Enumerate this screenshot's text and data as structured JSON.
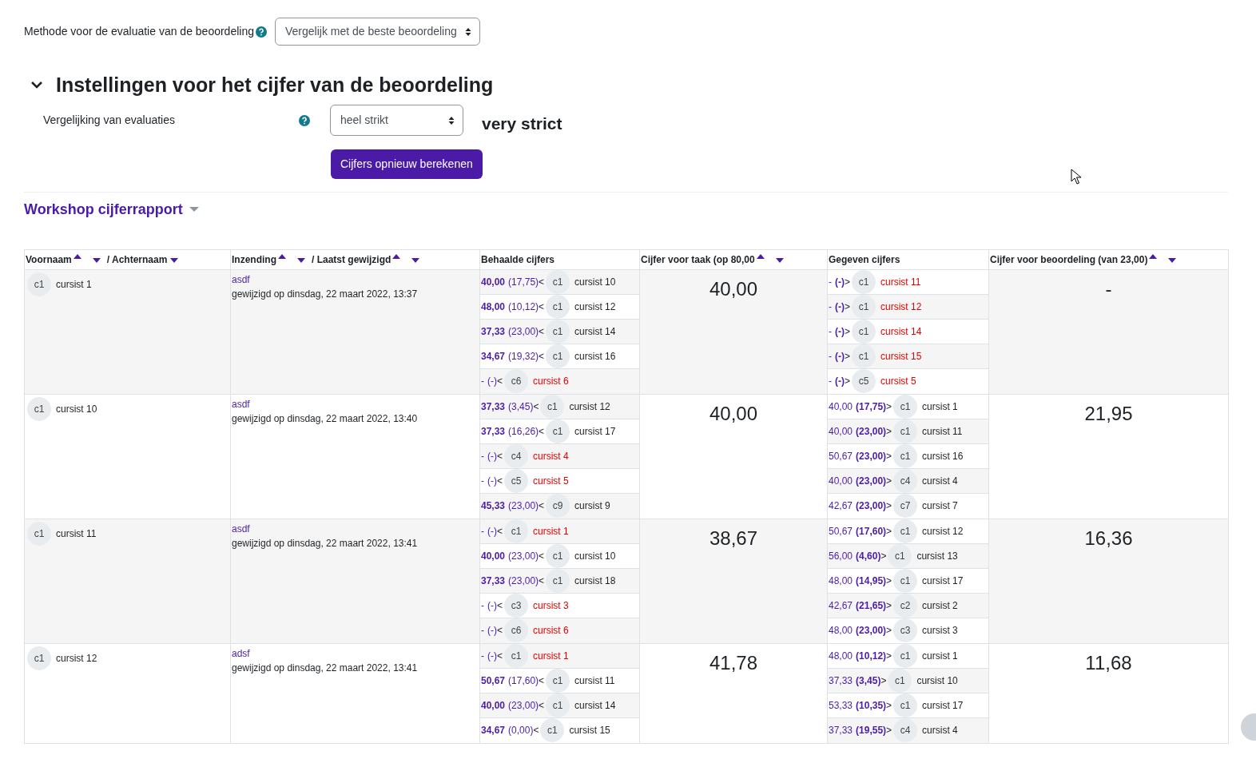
{
  "method": {
    "label": "Methode voor de evaluatie van de beoordeling",
    "value": "Vergelijk met de beste beoordeling"
  },
  "section": {
    "title": "Instellingen voor het cijfer van de beoordeling",
    "expanded": true,
    "field_label": "Vergelijking van evaluaties",
    "field_value": "heel strikt",
    "note": "very strict",
    "button": "Cijfers opnieuw berekenen"
  },
  "report": {
    "title": "Workshop cijferrapport"
  },
  "table": {
    "columns": [
      {
        "parts": [
          {
            "label": "Voornaam",
            "sort_up": true,
            "sort_down": true
          },
          {
            "label": "/ Achternaam",
            "sort_up": false,
            "sort_down": true
          }
        ]
      },
      {
        "parts": [
          {
            "label": "Inzending",
            "sort_up": true,
            "sort_down": true
          },
          {
            "label": "/ Laatst gewijzigd",
            "sort_up": true,
            "sort_down": true
          }
        ]
      },
      {
        "parts": [
          {
            "label": "Behaalde cijfers",
            "sort_up": false,
            "sort_down": false
          }
        ]
      },
      {
        "parts": [
          {
            "label": "Cijfer voor taak (op 80,00",
            "sort_up": true,
            "sort_down": true
          }
        ]
      },
      {
        "parts": [
          {
            "label": "Gegeven cijfers",
            "sort_up": false,
            "sort_down": false
          }
        ]
      },
      {
        "parts": [
          {
            "label": "Cijfer voor beoordeling (van 23,00)",
            "sort_up": true,
            "sort_down": true
          }
        ]
      }
    ],
    "rows": [
      {
        "avatar": "c1",
        "name": "cursist 1",
        "submission": "asdf",
        "modified": "gewijzigd op dinsdag, 22 maart 2022, 13:37",
        "task_grade": "40,00",
        "assessment_grade": "-",
        "received": [
          {
            "grade": "40,00",
            "weight": "(17,75)",
            "arrow": "<",
            "avatar": "c1",
            "name": "cursist 10",
            "done": true
          },
          {
            "grade": "48,00",
            "weight": "(10,12)",
            "arrow": "<",
            "avatar": "c1",
            "name": "cursist 12",
            "done": true
          },
          {
            "grade": "37,33",
            "weight": "(23,00)",
            "arrow": "<",
            "avatar": "c1",
            "name": "cursist 14",
            "done": true
          },
          {
            "grade": "34,67",
            "weight": "(19,32)",
            "arrow": "<",
            "avatar": "c1",
            "name": "cursist 16",
            "done": true
          },
          {
            "grade": "-",
            "weight": "(-)",
            "arrow": "<",
            "avatar": "c6",
            "name": "cursist 6",
            "done": false
          }
        ],
        "given": [
          {
            "grade": "-",
            "weight": "(-)",
            "arrow": ">",
            "avatar": "c1",
            "name": "cursist 11",
            "done": false
          },
          {
            "grade": "-",
            "weight": "(-)",
            "arrow": ">",
            "avatar": "c1",
            "name": "cursist 12",
            "done": false
          },
          {
            "grade": "-",
            "weight": "(-)",
            "arrow": ">",
            "avatar": "c1",
            "name": "cursist 14",
            "done": false
          },
          {
            "grade": "-",
            "weight": "(-)",
            "arrow": ">",
            "avatar": "c1",
            "name": "cursist 15",
            "done": false
          },
          {
            "grade": "-",
            "weight": "(-)",
            "arrow": ">",
            "avatar": "c5",
            "name": "cursist 5",
            "done": false
          }
        ]
      },
      {
        "avatar": "c1",
        "name": "cursist 10",
        "submission": "asdf",
        "modified": "gewijzigd op dinsdag, 22 maart 2022, 13:40",
        "task_grade": "40,00",
        "assessment_grade": "21,95",
        "received": [
          {
            "grade": "37,33",
            "weight": "(3,45)",
            "arrow": "<",
            "avatar": "c1",
            "name": "cursist 12",
            "done": true
          },
          {
            "grade": "37,33",
            "weight": "(16,26)",
            "arrow": "<",
            "avatar": "c1",
            "name": "cursist 17",
            "done": true
          },
          {
            "grade": "-",
            "weight": "(-)",
            "arrow": "<",
            "avatar": "c4",
            "name": "cursist 4",
            "done": false
          },
          {
            "grade": "-",
            "weight": "(-)",
            "arrow": "<",
            "avatar": "c5",
            "name": "cursist 5",
            "done": false
          },
          {
            "grade": "45,33",
            "weight": "(23,00)",
            "arrow": "<",
            "avatar": "c9",
            "name": "cursist 9",
            "done": true
          }
        ],
        "given": [
          {
            "grade": "40,00",
            "weight": "(17,75)",
            "arrow": ">",
            "avatar": "c1",
            "name": "cursist 1",
            "done": true
          },
          {
            "grade": "40,00",
            "weight": "(23,00)",
            "arrow": ">",
            "avatar": "c1",
            "name": "cursist 11",
            "done": true
          },
          {
            "grade": "50,67",
            "weight": "(23,00)",
            "arrow": ">",
            "avatar": "c1",
            "name": "cursist 16",
            "done": true
          },
          {
            "grade": "40,00",
            "weight": "(23,00)",
            "arrow": ">",
            "avatar": "c4",
            "name": "cursist 4",
            "done": true
          },
          {
            "grade": "42,67",
            "weight": "(23,00)",
            "arrow": ">",
            "avatar": "c7",
            "name": "cursist 7",
            "done": true
          }
        ]
      },
      {
        "avatar": "c1",
        "name": "cursist 11",
        "submission": "asdf",
        "modified": "gewijzigd op dinsdag, 22 maart 2022, 13:41",
        "task_grade": "38,67",
        "assessment_grade": "16,36",
        "received": [
          {
            "grade": "-",
            "weight": "(-)",
            "arrow": "<",
            "avatar": "c1",
            "name": "cursist 1",
            "done": false
          },
          {
            "grade": "40,00",
            "weight": "(23,00)",
            "arrow": "<",
            "avatar": "c1",
            "name": "cursist 10",
            "done": true
          },
          {
            "grade": "37,33",
            "weight": "(23,00)",
            "arrow": "<",
            "avatar": "c1",
            "name": "cursist 18",
            "done": true
          },
          {
            "grade": "-",
            "weight": "(-)",
            "arrow": "<",
            "avatar": "c3",
            "name": "cursist 3",
            "done": false
          },
          {
            "grade": "-",
            "weight": "(-)",
            "arrow": "<",
            "avatar": "c6",
            "name": "cursist 6",
            "done": false
          }
        ],
        "given": [
          {
            "grade": "50,67",
            "weight": "(17,60)",
            "arrow": ">",
            "avatar": "c1",
            "name": "cursist 12",
            "done": true
          },
          {
            "grade": "56,00",
            "weight": "(4,60)",
            "arrow": ">",
            "avatar": "c1",
            "name": "cursist 13",
            "done": true
          },
          {
            "grade": "48,00",
            "weight": "(14,95)",
            "arrow": ">",
            "avatar": "c1",
            "name": "cursist 17",
            "done": true
          },
          {
            "grade": "42,67",
            "weight": "(21,65)",
            "arrow": ">",
            "avatar": "c2",
            "name": "cursist 2",
            "done": true
          },
          {
            "grade": "48,00",
            "weight": "(23,00)",
            "arrow": ">",
            "avatar": "c3",
            "name": "cursist 3",
            "done": true
          }
        ]
      },
      {
        "avatar": "c1",
        "name": "cursist 12",
        "submission": "adsf",
        "modified": "gewijzigd op dinsdag, 22 maart 2022, 13:41",
        "task_grade": "41,78",
        "assessment_grade": "11,68",
        "received": [
          {
            "grade": "-",
            "weight": "(-)",
            "arrow": "<",
            "avatar": "c1",
            "name": "cursist 1",
            "done": false
          },
          {
            "grade": "50,67",
            "weight": "(17,60)",
            "arrow": "<",
            "avatar": "c1",
            "name": "cursist 11",
            "done": true
          },
          {
            "grade": "40,00",
            "weight": "(23,00)",
            "arrow": "<",
            "avatar": "c1",
            "name": "cursist 14",
            "done": true
          },
          {
            "grade": "34,67",
            "weight": "(0,00)",
            "arrow": "<",
            "avatar": "c1",
            "name": "cursist 15",
            "done": true
          }
        ],
        "given": [
          {
            "grade": "48,00",
            "weight": "(10,12)",
            "arrow": ">",
            "avatar": "c1",
            "name": "cursist 1",
            "done": true
          },
          {
            "grade": "37,33",
            "weight": "(3,45)",
            "arrow": ">",
            "avatar": "c1",
            "name": "cursist 10",
            "done": true
          },
          {
            "grade": "53,33",
            "weight": "(10,35)",
            "arrow": ">",
            "avatar": "c1",
            "name": "cursist 17",
            "done": true
          },
          {
            "grade": "37,33",
            "weight": "(19,55)",
            "arrow": ">",
            "avatar": "c4",
            "name": "cursist 4",
            "done": true
          }
        ]
      }
    ]
  }
}
